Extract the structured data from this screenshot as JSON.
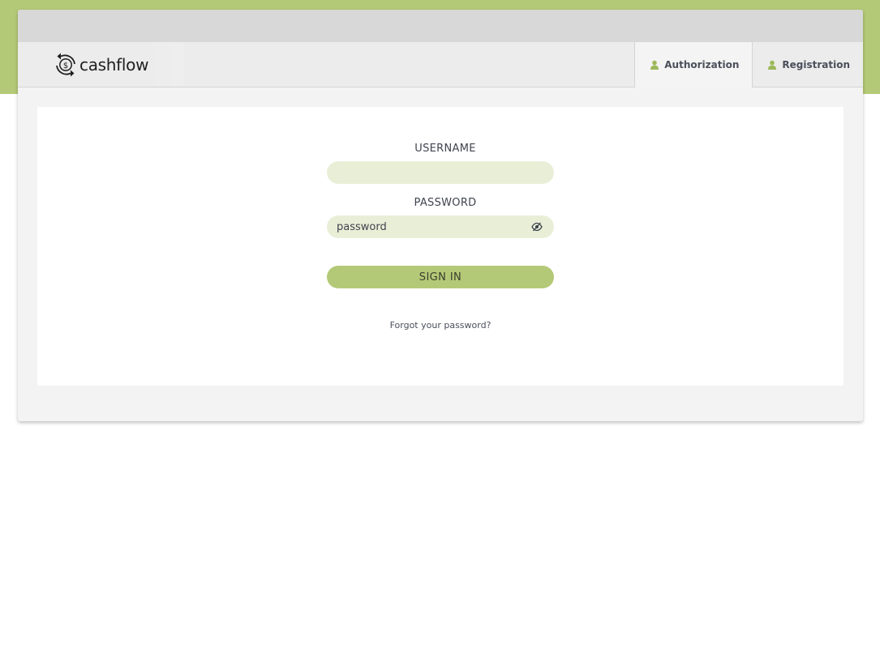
{
  "colors": {
    "accent": "#b4c977",
    "input_bg": "#e9efd7",
    "header_bg": "#ececec",
    "window_bar": "#d8d8d8"
  },
  "header": {
    "logo_text": "cashflow",
    "logo_icon": "dollar-cycle-icon",
    "tabs": [
      {
        "label": "Authorization",
        "icon": "user-icon",
        "active": true
      },
      {
        "label": "Registration",
        "icon": "user-icon",
        "active": false
      }
    ]
  },
  "login": {
    "username_label": "USERNAME",
    "username_value": "",
    "password_label": "PASSWORD",
    "password_value": "password",
    "password_toggle_icon": "eye-slash-icon",
    "signin_label": "SIGN IN",
    "forgot_label": "Forgot your password?"
  }
}
